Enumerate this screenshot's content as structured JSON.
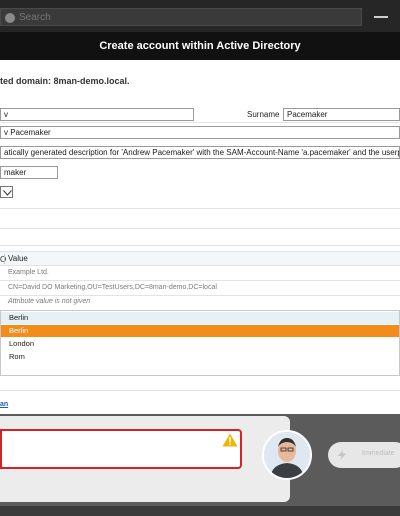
{
  "search": {
    "placeholder": "Search"
  },
  "header": {
    "title": "Create account within Active Directory"
  },
  "domain_text": "ted domain: 8man-demo.local.",
  "form": {
    "first_name_value": "v",
    "surname_label": "Surname",
    "surname_value": "Pacemaker",
    "display_name_value": "v Pacemaker",
    "description_value": "atically generated description for 'Andrew Pacemaker' with the SAM-Account-Name 'a.pacemaker' and the userprin",
    "account_value": "maker"
  },
  "table": {
    "header_stub": "O",
    "value_header": "Value",
    "rows": [
      {
        "text": "Example Ltd.",
        "italic": false
      },
      {
        "text": "CN=David DO Marketing,OU=TestUsers,DC=8man-demo,DC=local",
        "italic": false
      },
      {
        "text": "Attribute value is not given",
        "italic": true
      }
    ]
  },
  "dropdown_options": [
    {
      "label": "Berlin",
      "state": "selected"
    },
    {
      "label": "Berlin",
      "state": "highlight"
    },
    {
      "label": "London",
      "state": "normal"
    },
    {
      "label": "Rom",
      "state": "normal"
    }
  ],
  "link_text": "an",
  "action": {
    "label": "Immediate"
  },
  "icons": {
    "search": "search-icon",
    "minimize": "minimize-icon",
    "dropdown": "chevron-down-icon",
    "warning": "warning-icon",
    "avatar": "avatar",
    "action": "flash-icon"
  },
  "colors": {
    "highlight": "#f28c1b",
    "error_border": "#d42323",
    "link": "#1f5fae",
    "header_bg": "#111111"
  }
}
